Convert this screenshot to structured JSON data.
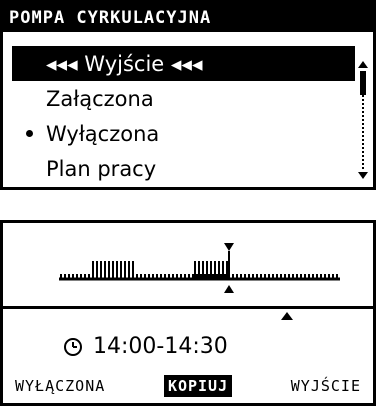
{
  "menu": {
    "title": "POMPA CYRKULACYJNA",
    "items": [
      {
        "label": "◂◂◂ Wyjście ◂◂◂",
        "selected": true,
        "bullet": false
      },
      {
        "label": "Załączona",
        "selected": false,
        "bullet": false
      },
      {
        "label": "Wyłączona",
        "selected": false,
        "bullet": true
      },
      {
        "label": "Plan pracy",
        "selected": false,
        "bullet": false
      }
    ],
    "scroll_position": 0
  },
  "schedule": {
    "time_range": "14:00-14:30",
    "footer": {
      "off_label": "WYŁĄCZONA",
      "copy_label": "KOPIUJ",
      "exit_label": "WYJŚCIE",
      "active": "copy"
    }
  }
}
